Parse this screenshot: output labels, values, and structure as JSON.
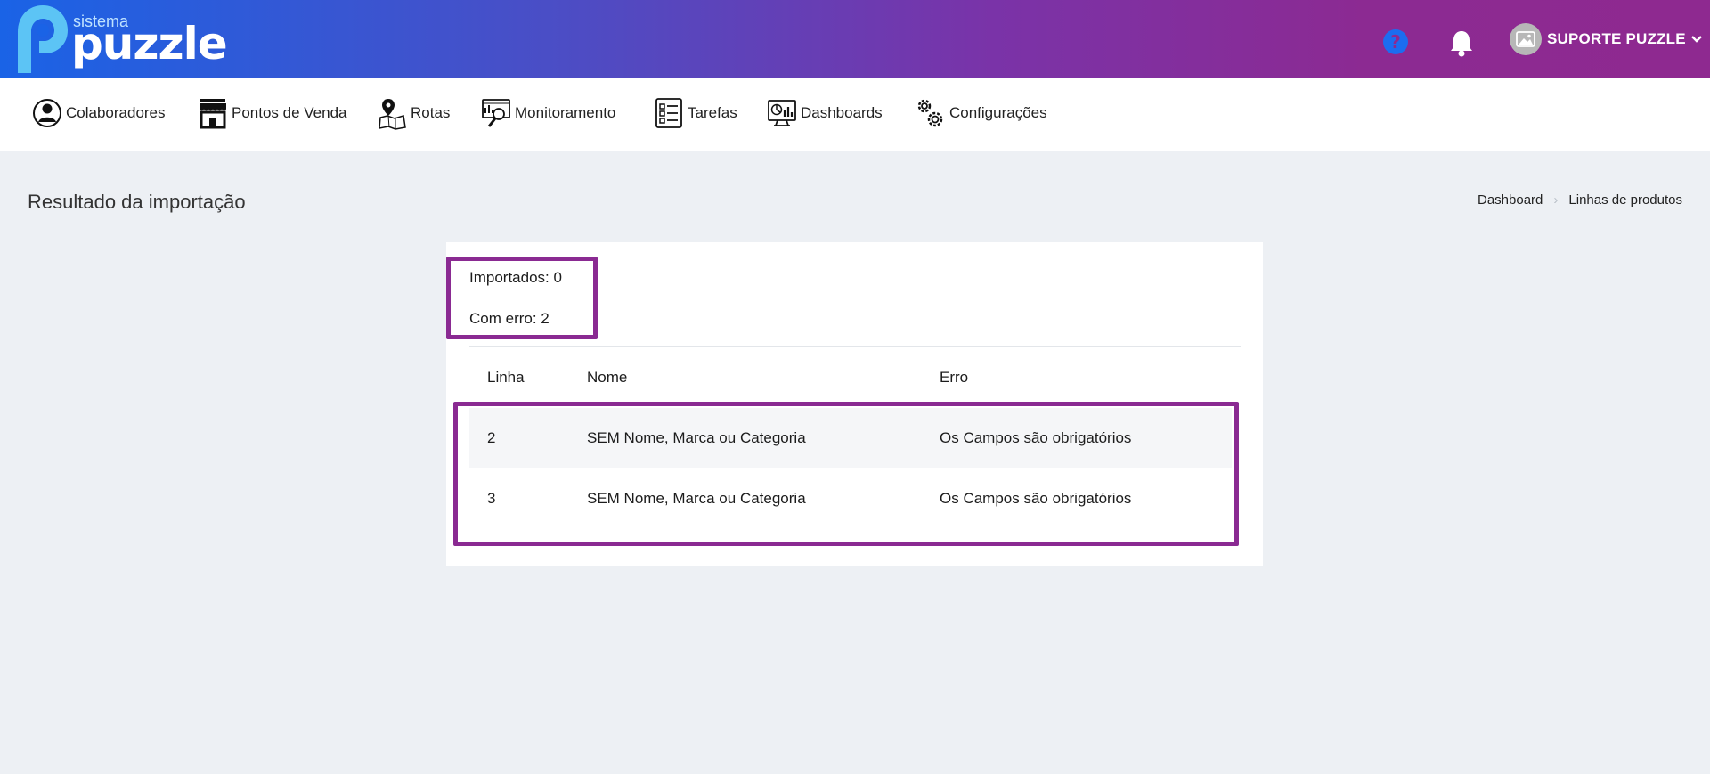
{
  "header": {
    "logo_small": "sistema",
    "logo_big": "puzzle",
    "user_name": "SUPORTE PUZZLE",
    "colors": {
      "gradient_start": "#1a63e6",
      "gradient_end": "#8e2990",
      "highlight": "#8a2a92"
    }
  },
  "nav": {
    "items": [
      {
        "label": "Colaboradores",
        "icon": "user-circle-icon"
      },
      {
        "label": "Pontos de Venda",
        "icon": "store-icon"
      },
      {
        "label": "Rotas",
        "icon": "map-pin-icon"
      },
      {
        "label": "Monitoramento",
        "icon": "monitor-search-icon"
      },
      {
        "label": "Tarefas",
        "icon": "checklist-icon"
      },
      {
        "label": "Dashboards",
        "icon": "dashboard-monitor-icon"
      },
      {
        "label": "Configurações",
        "icon": "gears-icon"
      }
    ]
  },
  "page": {
    "title": "Resultado da importação",
    "breadcrumb": [
      "Dashboard",
      "Linhas de produtos"
    ]
  },
  "summary": {
    "imported": "Importados: 0",
    "errors": "Com erro: 2"
  },
  "table": {
    "columns": [
      "Linha",
      "Nome",
      "Erro"
    ],
    "rows": [
      {
        "line": "2",
        "name": "SEM Nome, Marca ou Categoria",
        "error": "Os Campos são obrigatórios"
      },
      {
        "line": "3",
        "name": "SEM Nome, Marca ou Categoria",
        "error": "Os Campos são obrigatórios"
      }
    ]
  }
}
